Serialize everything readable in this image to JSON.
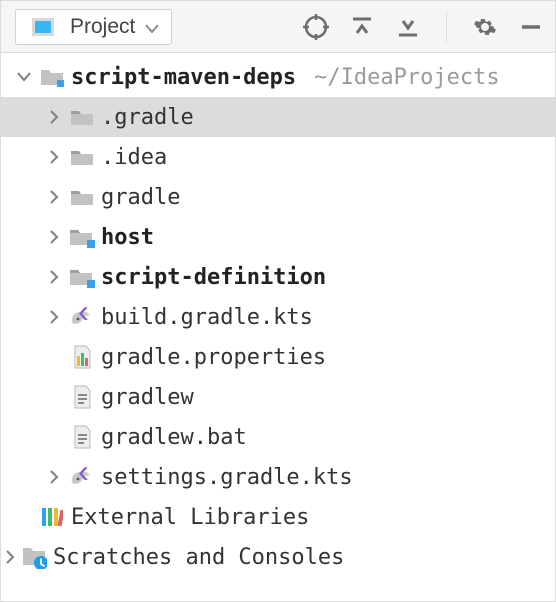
{
  "toolbar": {
    "title": "Project"
  },
  "tree": {
    "root": {
      "name": "script-maven-deps",
      "path": "~/IdeaProjects"
    },
    "items": [
      {
        "name": ".gradle",
        "kind": "folder",
        "bold": false,
        "expandable": true,
        "selected": true
      },
      {
        "name": ".idea",
        "kind": "folder",
        "bold": false,
        "expandable": true,
        "selected": false
      },
      {
        "name": "gradle",
        "kind": "folder",
        "bold": false,
        "expandable": true,
        "selected": false
      },
      {
        "name": "host",
        "kind": "module",
        "bold": true,
        "expandable": true,
        "selected": false
      },
      {
        "name": "script-definition",
        "kind": "module",
        "bold": true,
        "expandable": true,
        "selected": false
      },
      {
        "name": "build.gradle.kts",
        "kind": "gradle-kts",
        "bold": false,
        "expandable": true,
        "selected": false
      },
      {
        "name": "gradle.properties",
        "kind": "properties",
        "bold": false,
        "expandable": false,
        "selected": false
      },
      {
        "name": "gradlew",
        "kind": "textfile",
        "bold": false,
        "expandable": false,
        "selected": false
      },
      {
        "name": "gradlew.bat",
        "kind": "textfile",
        "bold": false,
        "expandable": false,
        "selected": false
      },
      {
        "name": "settings.gradle.kts",
        "kind": "gradle-kts",
        "bold": false,
        "expandable": true,
        "selected": false
      }
    ],
    "external": "External Libraries",
    "scratches": "Scratches and Consoles"
  }
}
